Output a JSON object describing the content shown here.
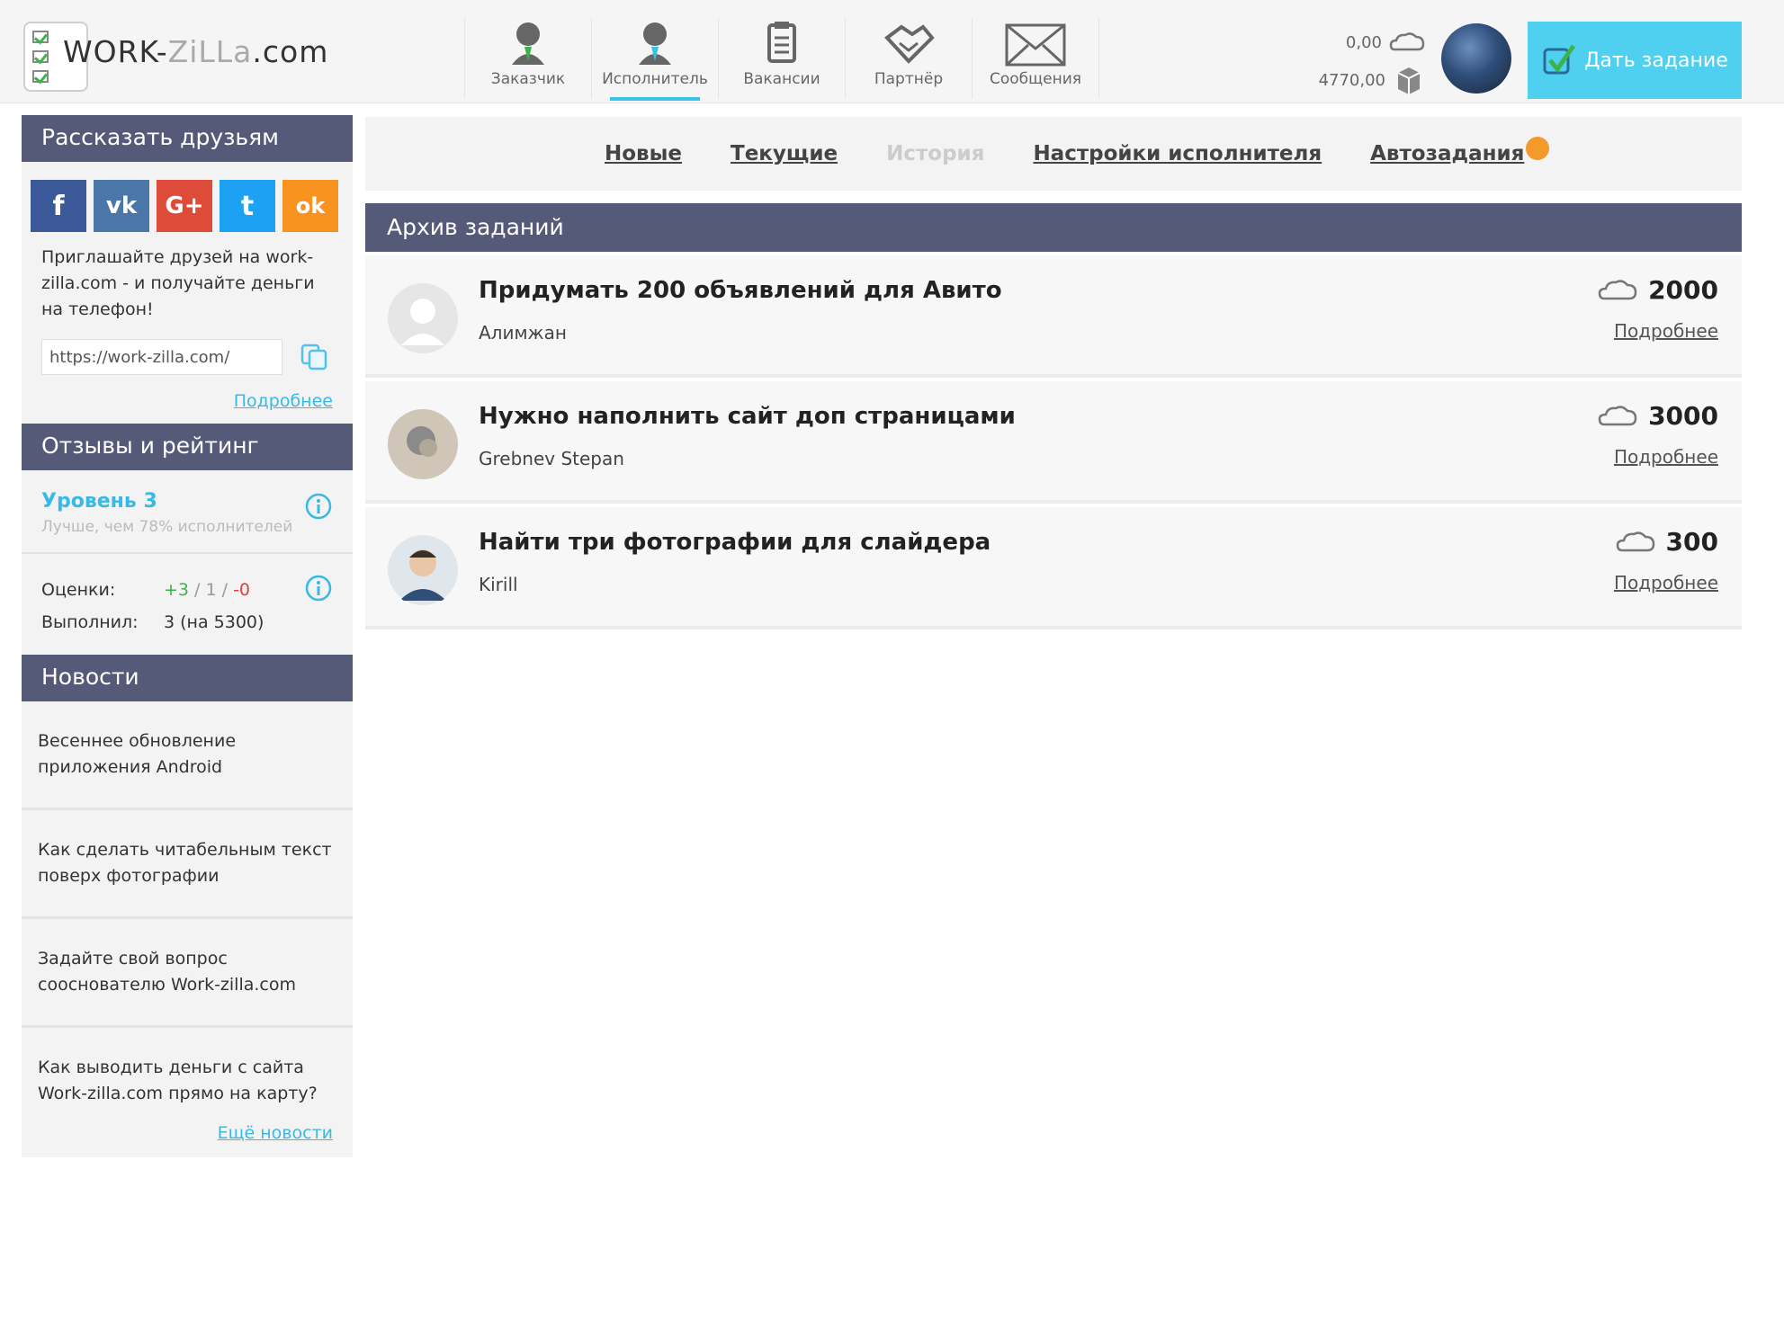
{
  "header": {
    "logo_prefix": "WORK-",
    "logo_mid": "ZiLLa",
    "logo_suffix": ".com",
    "nav": [
      {
        "label": "Заказчик",
        "icon": "customer-icon"
      },
      {
        "label": "Исполнитель",
        "icon": "executor-icon",
        "active": true
      },
      {
        "label": "Вакансии",
        "icon": "vacancies-icon"
      },
      {
        "label": "Партнёр",
        "icon": "handshake-icon"
      },
      {
        "label": "Сообщения",
        "icon": "envelope-icon"
      }
    ],
    "balance_primary": "0,00",
    "balance_secondary": "4770,00",
    "give_task_label": "Дать задание"
  },
  "sidebar": {
    "share_title": "Рассказать друзьям",
    "social": [
      {
        "name": "facebook",
        "glyph": "f",
        "color": "#3b5998"
      },
      {
        "name": "vk",
        "glyph": "vk",
        "color": "#4a76a8"
      },
      {
        "name": "google-plus",
        "glyph": "G+",
        "color": "#dd4b39"
      },
      {
        "name": "twitter",
        "glyph": "t",
        "color": "#1da1f2"
      },
      {
        "name": "odnoklassniki",
        "glyph": "ok",
        "color": "#f7931e"
      }
    ],
    "invite_text": "Приглашайте друзей на work-zilla.com - и получайте деньги на телефон!",
    "ref_link": "https://work-zilla.com/",
    "more_label": "Подробнее",
    "reviews_title": "Отзывы и рейтинг",
    "level_label": "Уровень 3",
    "level_sub": "Лучше, чем 78% исполнителей",
    "ratings_key": "Оценки:",
    "ratings_pos": "+3",
    "ratings_sep1": " / ",
    "ratings_neu": "1",
    "ratings_sep2": " / ",
    "ratings_neg": "-0",
    "done_key": "Выполнил:",
    "done_val": "3 (на 5300)",
    "news_title": "Новости",
    "news": [
      "Весеннее обновление приложения Android",
      "Как сделать читабельным текст поверх фотографии",
      "Задайте свой вопрос сооснователю Work-zilla.com",
      "Как выводить деньги с сайта Work-zilla.com прямо на карту?"
    ],
    "news_more": "Ещё новости"
  },
  "tabs": [
    "Новые",
    "Текущие",
    "История",
    "Настройки исполнителя",
    "Автозадания"
  ],
  "archive_title": "Архив заданий",
  "tasks": [
    {
      "title": "Придумать 200 объявлений для Авито",
      "author": "Алимжан",
      "price": "2000",
      "more": "Подробнее"
    },
    {
      "title": "Нужно наполнить сайт доп страницами",
      "author": "Grebnev Stepan",
      "price": "3000",
      "more": "Подробнее"
    },
    {
      "title": "Найти три фотографии для слайдера",
      "author": "Kirill",
      "price": "300",
      "more": "Подробнее"
    }
  ]
}
